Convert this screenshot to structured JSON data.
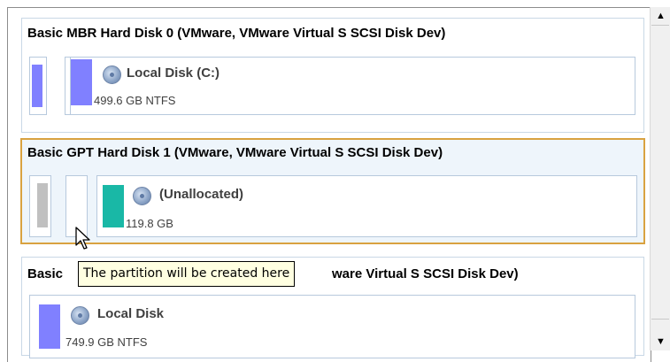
{
  "disks": [
    {
      "title": "Basic MBR Hard Disk 0 (VMware, VMware Virtual S SCSI Disk Dev)",
      "partition": {
        "label": "Local Disk (C:)",
        "info": "499.6 GB NTFS",
        "color": "#8080ff"
      }
    },
    {
      "title": "Basic GPT Hard Disk 1 (VMware, VMware Virtual S SCSI Disk Dev)",
      "partition": {
        "label": "(Unallocated)",
        "info": "119.8 GB",
        "color": "#19b8a6"
      }
    },
    {
      "title_left": "Basic",
      "title_right": "ware Virtual S SCSI Disk Dev)",
      "partition": {
        "label": "Local Disk",
        "info": "749.9 GB NTFS",
        "color": "#8080ff"
      }
    }
  ],
  "tooltip": "The partition will be created here",
  "scrollbar": {
    "up_icon": "▲",
    "down_icon": "▼"
  },
  "colors": {
    "selection_border": "#d9a240",
    "selected_bg": "#eef5fb",
    "tooltip_bg": "#ffffe1"
  }
}
